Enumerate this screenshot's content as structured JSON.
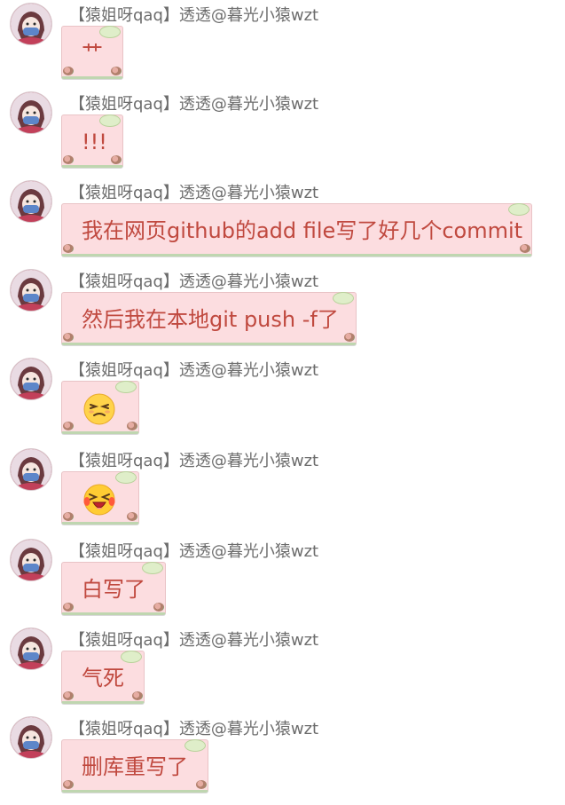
{
  "accent": {
    "bubble_bg": "#fcdde0",
    "bubble_text": "#c0493f",
    "sender_text": "#6c6c6c"
  },
  "messages": [
    {
      "sender": "【猿姐呀qaq】透透@暮光小猿wzt",
      "text": "艹"
    },
    {
      "sender": "【猿姐呀qaq】透透@暮光小猿wzt",
      "text": "!!!"
    },
    {
      "sender": "【猿姐呀qaq】透透@暮光小猿wzt",
      "text": "我在网页github的add file写了好几个commit"
    },
    {
      "sender": "【猿姐呀qaq】透透@暮光小猿wzt",
      "text": "然后我在本地git push -f了"
    },
    {
      "sender": "【猿姐呀qaq】透透@暮光小猿wzt",
      "emoji": "squinting-annoyed-face"
    },
    {
      "sender": "【猿姐呀qaq】透透@暮光小猿wzt",
      "emoji": "crying-laughing-face"
    },
    {
      "sender": "【猿姐呀qaq】透透@暮光小猿wzt",
      "text": "白写了"
    },
    {
      "sender": "【猿姐呀qaq】透透@暮光小猿wzt",
      "text": "气死"
    },
    {
      "sender": "【猿姐呀qaq】透透@暮光小猿wzt",
      "text": "删库重写了"
    }
  ]
}
